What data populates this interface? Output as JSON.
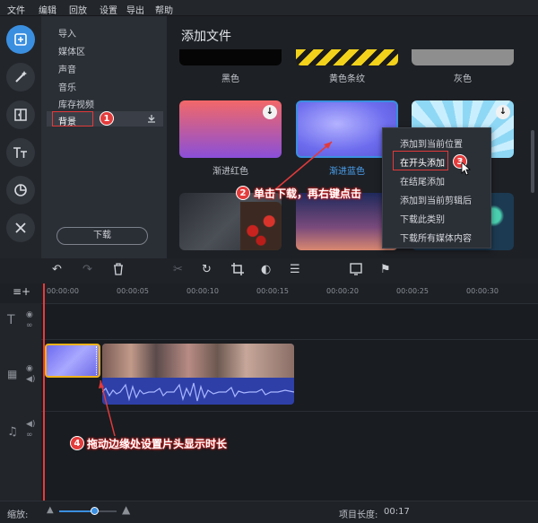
{
  "menu": [
    "文件",
    "编辑",
    "回放",
    "设置",
    "导出",
    "帮助"
  ],
  "sidebar_icons": [
    "import-icon",
    "magic-wand-icon",
    "transition-icon",
    "text-icon",
    "clock-filter-icon",
    "tools-icon"
  ],
  "categories": [
    "导入",
    "媒体区",
    "声音",
    "音乐",
    "库存视频",
    "背景"
  ],
  "download_button": "下载",
  "content": {
    "title": "添加文件",
    "row1_labels": [
      "黑色",
      "黄色条纹",
      "灰色"
    ],
    "row2_labels": [
      "渐进红色",
      "渐进蓝色",
      ""
    ]
  },
  "context_menu": [
    "添加到当前位置",
    "在开头添加",
    "在结尾添加",
    "添加到当前剪辑后",
    "下载此类别",
    "下载所有媒体内容"
  ],
  "annotations": {
    "b1": "1",
    "b2": "2",
    "b3": "3",
    "b4": "4",
    "a2": "单击下载，再右键点击",
    "a4": "拖动边缘处设置片头显示时长"
  },
  "ruler_ticks": [
    "00:00:00",
    "00:00:05",
    "00:00:10",
    "00:00:15",
    "00:00:20",
    "00:00:25",
    "00:00:30"
  ],
  "status": {
    "zoom_label": "缩放:",
    "length_label": "项目长度:",
    "length_value": "00:17"
  },
  "colors": {
    "accent": "#3b8fe0",
    "highlight": "#e23a3a",
    "clip_border": "#f0b21c"
  }
}
